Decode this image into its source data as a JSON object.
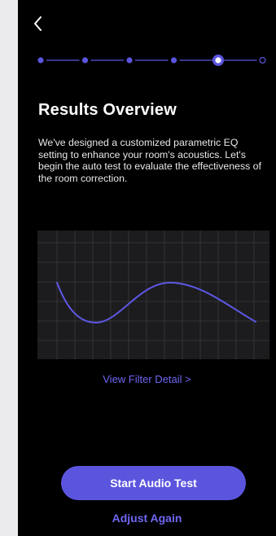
{
  "header": {
    "back_icon": "chevron-left-icon"
  },
  "stepper": {
    "total_steps": 6,
    "current_step": 5
  },
  "content": {
    "title": "Results Overview",
    "description": "We've designed a customized parametric EQ setting to enhance your room's acoustics. Let's begin the auto test to evaluate the effectiveness of the room correction."
  },
  "eq_chart": {
    "grid": true
  },
  "links": {
    "view_filter_detail": "View Filter Detail >"
  },
  "actions": {
    "start_audio_test": "Start Audio Test",
    "adjust_again": "Adjust Again"
  },
  "colors": {
    "accent": "#5b55de",
    "accent_text": "#6f67f2",
    "background": "#000000",
    "chart_background": "#1c1c1e",
    "grid_line": "#3a3a3c",
    "curve": "#5e57e6"
  }
}
